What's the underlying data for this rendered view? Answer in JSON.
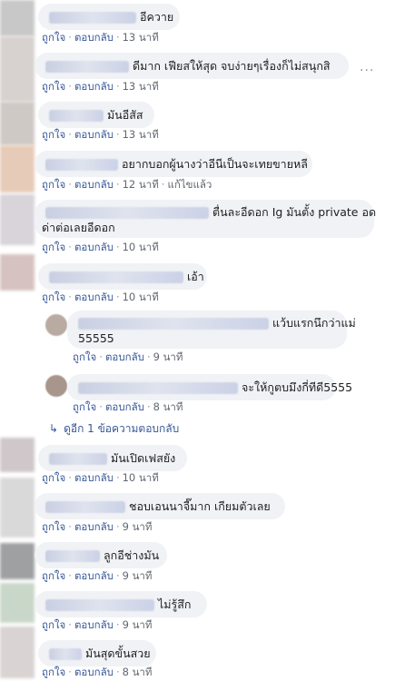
{
  "labels": {
    "like": "ถูกใจ",
    "reply": "ตอบกลับ",
    "edited": "แก้ไขแล้ว",
    "dot": "·",
    "more": "···"
  },
  "comments": [
    {
      "text": "อีควาย",
      "time": "13 นาที"
    },
    {
      "text": "ดีมาก เฟียสให้สุด จบง่ายๆเรื่องก็ไม่สนุกสิ",
      "time": "13 นาที"
    },
    {
      "text": "มันอีสัส",
      "time": "13 นาที"
    },
    {
      "text": "อยากบอกผู้นางว่าอีนีเป็นจะเทยขายหลี",
      "time": "12 นาที"
    },
    {
      "text": "ตื่นละอีดอก Ig มันตั้ง private อด",
      "text2": "ด่าต่อเลยอีดอก",
      "time": "10 นาที"
    },
    {
      "text": "เอ้า",
      "time": "10 นาที"
    },
    {
      "text": "แว้บแรกนึกว่าแม่",
      "text2": "55555",
      "time": "9 นาที"
    },
    {
      "text": "จะให้กูตบมึงกี่ทีดี5555",
      "time": "8 นาที"
    },
    {
      "text": "มันเปิดเฟสยัง",
      "time": "10 นาที"
    },
    {
      "text": "ชอบเอนนาจี๊มาก เกียมตัวเลย",
      "time": "9 นาที"
    },
    {
      "text": "ลูกอีช่างมัน",
      "time": "9 นาที"
    },
    {
      "text": "ไม่รู้สึก",
      "time": "9 นาที"
    },
    {
      "text": "มันสุดขั้นสวย",
      "time": "8 นาที"
    }
  ],
  "view_replies": "ดูอีก 1 ข้อความตอบกลับ",
  "colors": {
    "bubble": "#f0f2f5",
    "link": "#385898",
    "meta": "#616770"
  }
}
